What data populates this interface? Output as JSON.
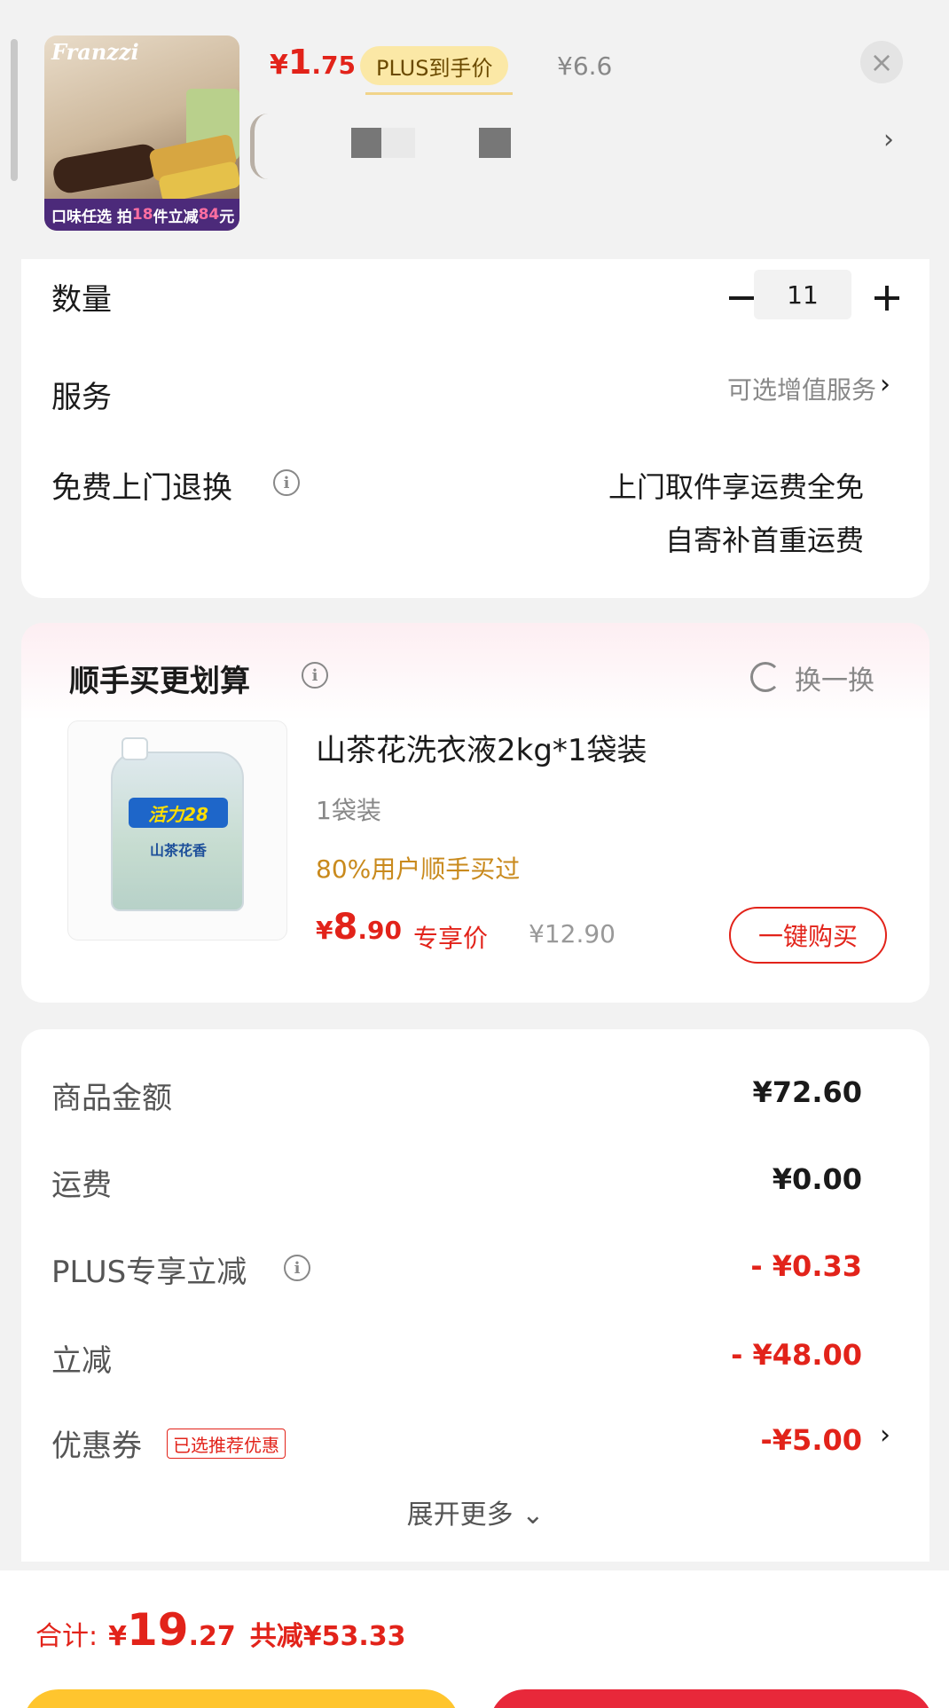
{
  "product": {
    "thumbnail_brand": "Franzzi",
    "thumbnail_badge_prefix": "口味任选  拍",
    "thumbnail_badge_qty": "18",
    "thumbnail_badge_mid": "件立减",
    "thumbnail_badge_amount": "84",
    "thumbnail_badge_suffix": "元",
    "price_currency": "¥",
    "price_int": "1",
    "price_dec": ".75",
    "plus_tag": "PLUS到手价",
    "original_price": "¥6.6",
    "close_icon": "×",
    "chevron": "›"
  },
  "options": {
    "quantity_label": "数量",
    "quantity_value": "11",
    "service_label": "服务",
    "service_value": "可选增值服务",
    "return_label": "免费上门退换",
    "return_line1": "上门取件享运费全免",
    "return_line2": "自寄补首重运费",
    "chevron": "›",
    "info_icon": "i"
  },
  "recommend": {
    "title": "顺手买更划算",
    "swap_label": "换一换",
    "item_logo": "活力28",
    "item_pack_text": "山茶花香",
    "item_name": "山茶花洗衣液2kg*1袋装",
    "item_spec": "1袋装",
    "item_social": "80%用户顺手买过",
    "price_currency": "¥",
    "price_int": "8",
    "price_dec": ".90",
    "exclusive_label": "专享价",
    "original_price": "¥12.90",
    "buy_button": "一键购买",
    "info_icon": "i"
  },
  "summary": {
    "goods_label": "商品金额",
    "goods_value": "¥72.60",
    "shipping_label": "运费",
    "shipping_value": "¥0.00",
    "plus_label": "PLUS专享立减",
    "plus_value": "- ¥0.33",
    "discount_label": "立减",
    "discount_value": "- ¥48.00",
    "coupon_label": "优惠券",
    "coupon_tag": "已选推荐优惠",
    "coupon_value": "-¥5.00",
    "expand_label": "展开更多 ⌄",
    "chevron": "›",
    "info_icon": "i"
  },
  "footer": {
    "total_label": "合计:",
    "total_currency": "¥",
    "total_int": "19",
    "total_dec": ".27",
    "saved_text": "共减¥53.33"
  },
  "colors": {
    "accent_red": "#e2231a",
    "plus_gold": "#fbe8a6",
    "social_orange": "#c98a1d",
    "btn_yellow": "#ffc52e",
    "btn_red": "#e8283a"
  }
}
